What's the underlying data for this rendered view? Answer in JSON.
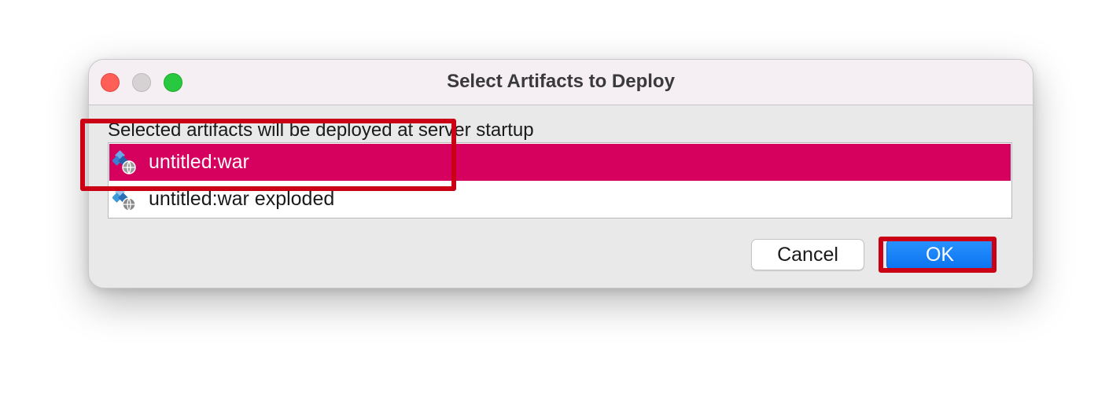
{
  "dialog": {
    "title": "Select Artifacts to Deploy",
    "caption": "Selected artifacts will be deployed at server startup",
    "artifacts": [
      {
        "label": "untitled:war",
        "selected": true,
        "icon": "artifact-web-icon"
      },
      {
        "label": "untitled:war exploded",
        "selected": false,
        "icon": "artifact-web-icon"
      }
    ],
    "buttons": {
      "cancel": "Cancel",
      "ok": "OK"
    }
  },
  "colors": {
    "selection": "#d6005f",
    "ok_button": "#0a72f0",
    "annotation_box": "#cc0015"
  }
}
